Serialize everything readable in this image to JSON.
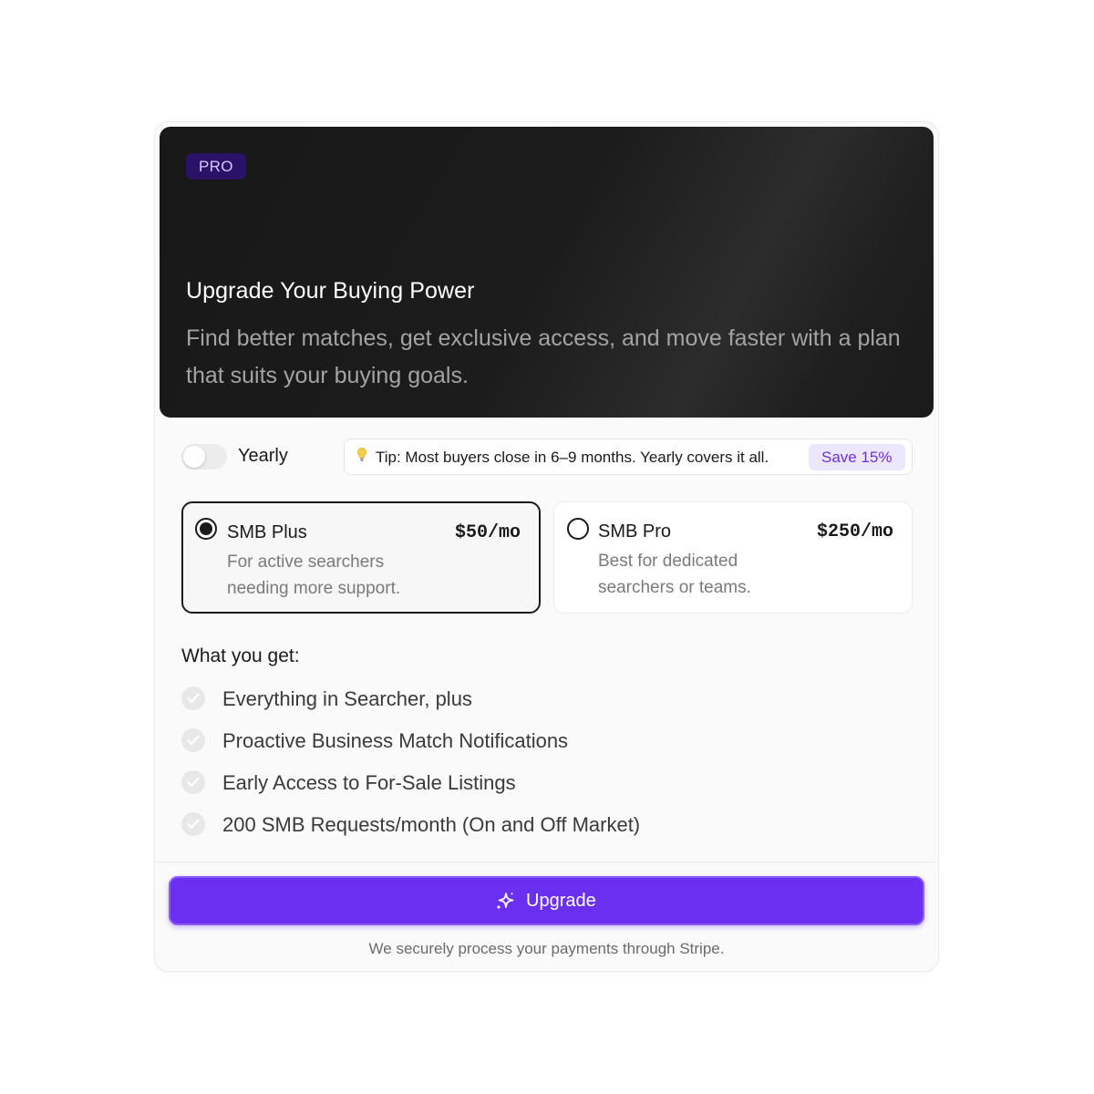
{
  "hero": {
    "badge": "PRO",
    "title": "Upgrade Your Buying Power",
    "subtitle": "Find better matches, get exclusive access, and move faster with a plan that suits your buying goals."
  },
  "billing": {
    "toggle_label": "Yearly",
    "toggle_on": false,
    "tip_text": "Tip: Most buyers close in 6–9 months. Yearly covers it all.",
    "save_badge": "Save 15%"
  },
  "plans": [
    {
      "name": "SMB Plus",
      "price": "$50/mo",
      "description": "For active searchers needing more support.",
      "selected": true
    },
    {
      "name": "SMB Pro",
      "price": "$250/mo",
      "description": "Best for dedicated searchers or teams.",
      "selected": false
    }
  ],
  "features": {
    "title": "What you get:",
    "items": [
      "Everything in Searcher, plus",
      "Proactive Business Match Notifications",
      "Early Access to For-Sale Listings",
      "200 SMB Requests/month (On and Off Market)"
    ]
  },
  "cta": {
    "label": "Upgrade",
    "note": "We securely process your payments through Stripe."
  },
  "colors": {
    "accent": "#6a2ff0",
    "badge_bg": "#2a1366",
    "save_badge_bg": "#ede7fe",
    "save_badge_text": "#6930e8"
  },
  "icons": {
    "tip": "lightbulb-icon",
    "feature": "check-circle-icon",
    "cta": "sparkles-icon"
  }
}
